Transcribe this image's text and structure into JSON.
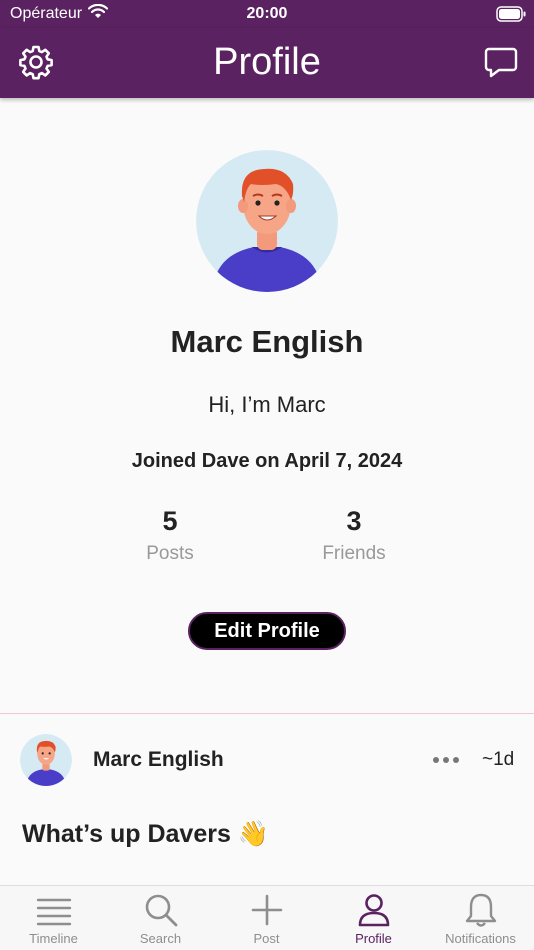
{
  "status_bar": {
    "carrier": "Opérateur",
    "time": "20:00"
  },
  "nav": {
    "title": "Profile",
    "settings_icon": "gear-icon",
    "messages_icon": "chat-bubble-icon",
    "color": "#5a2260"
  },
  "profile": {
    "name": "Marc English",
    "bio": "Hi, I’m Marc",
    "joined": "Joined Dave on April 7, 2024",
    "stats": {
      "posts": {
        "value": "5",
        "label": "Posts"
      },
      "friends": {
        "value": "3",
        "label": "Friends"
      }
    },
    "edit_button_label": "Edit Profile"
  },
  "post": {
    "author": "Marc English",
    "time": "~1d",
    "text": "What’s up Davers 👋",
    "more_icon": "more-horizontal-icon"
  },
  "tabs": [
    {
      "label": "Timeline",
      "icon": "list-icon",
      "active": false
    },
    {
      "label": "Search",
      "icon": "search-icon",
      "active": false
    },
    {
      "label": "Post",
      "icon": "plus-icon",
      "active": false
    },
    {
      "label": "Profile",
      "icon": "person-icon",
      "active": true
    },
    {
      "label": "Notifications",
      "icon": "bell-icon",
      "active": false
    }
  ],
  "colors": {
    "accent": "#5a2260",
    "inactive": "#8e8e8e",
    "avatar_bg": "#d6eaf3",
    "shirt": "#4a3ec8",
    "hair": "#e2502a"
  }
}
